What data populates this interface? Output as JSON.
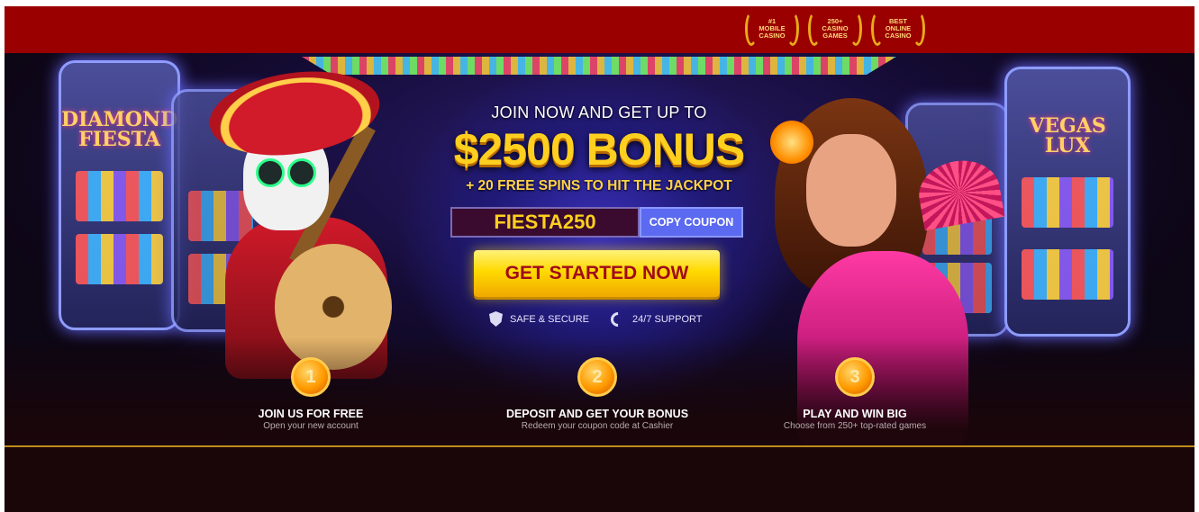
{
  "colors": {
    "topbar": "#9a0000",
    "background": "#1a0609",
    "accent_gold": "#ffcf1f",
    "cta_text": "#a00a1a",
    "copy_button": "#5b6af0"
  },
  "awards": [
    {
      "label": "#1\nMOBILE\nCASINO",
      "icon": "laurel-icon"
    },
    {
      "label": "250+\nCASINO\nGAMES",
      "icon": "laurel-icon"
    },
    {
      "label": "BEST\nONLINE\nCASINO",
      "icon": "laurel-icon"
    }
  ],
  "slots": {
    "left": {
      "title": "DIAMOND FIESTA"
    },
    "right": {
      "title": "VEGAS LUX"
    }
  },
  "promo": {
    "intro": "JOIN NOW AND GET UP TO",
    "headline": "$2500 BONUS",
    "subline": "+ 20 FREE SPINS TO HIT THE JACKPOT",
    "coupon_code": "FIESTA250",
    "copy_label": "COPY COUPON",
    "cta_label": "GET STARTED NOW"
  },
  "features": [
    {
      "label": "SAFE & SECURE",
      "icon": "shield-check-icon"
    },
    {
      "label": "24/7 SUPPORT",
      "icon": "phone-icon"
    }
  ],
  "steps": [
    {
      "number": "1",
      "title": "JOIN US FOR FREE",
      "subtitle": "Open your new account"
    },
    {
      "number": "2",
      "title": "DEPOSIT AND GET YOUR BONUS",
      "subtitle": "Redeem your coupon code at Cashier"
    },
    {
      "number": "3",
      "title": "PLAY AND WIN BIG",
      "subtitle": "Choose from 250+ top-rated games"
    }
  ]
}
